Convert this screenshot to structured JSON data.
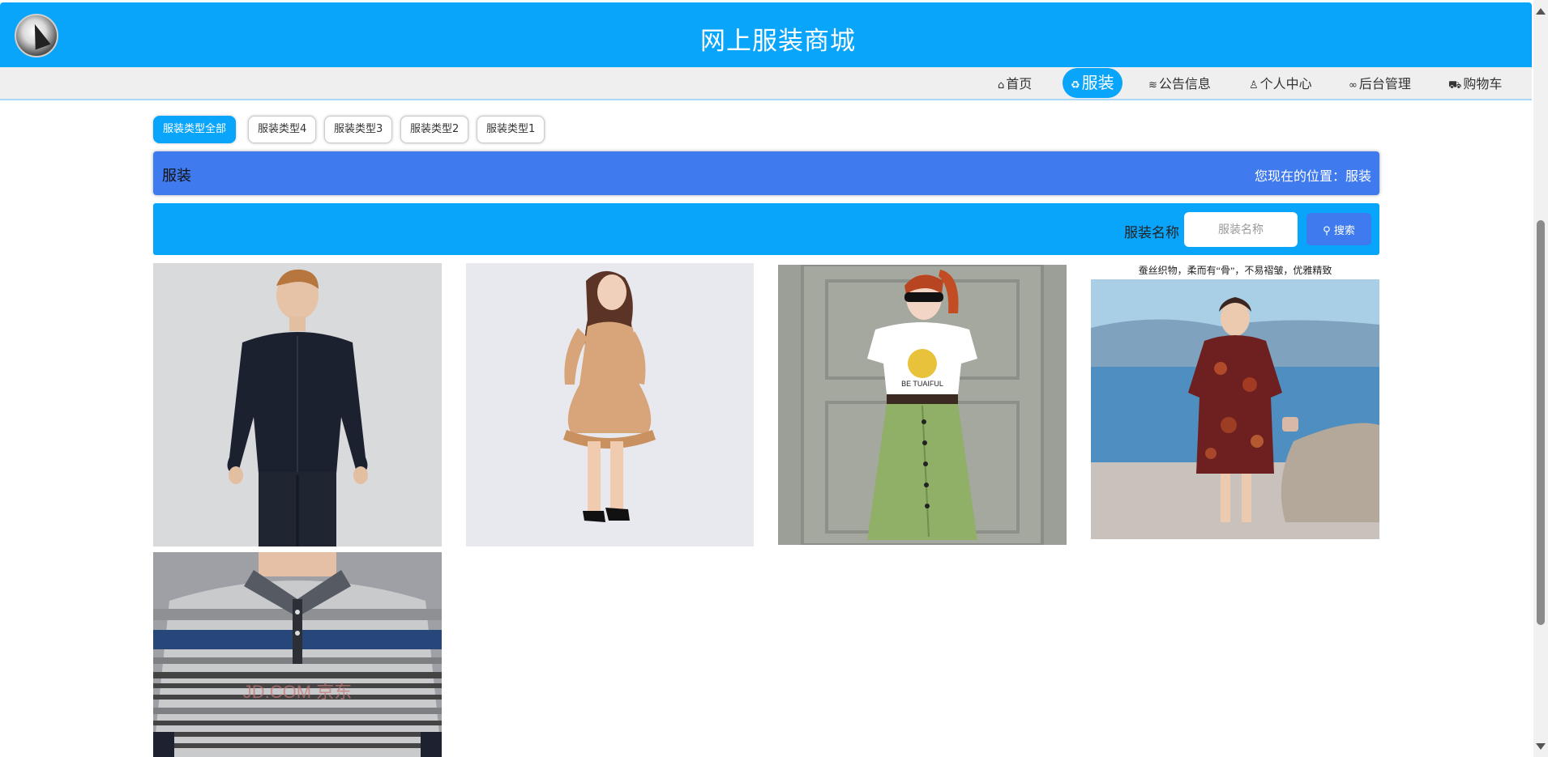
{
  "header": {
    "title": "网上服装商城",
    "logo_icon": "logo-icon"
  },
  "nav": {
    "items": [
      {
        "label": "首页",
        "icon": "home-icon",
        "glyph": "⌂"
      },
      {
        "label": "服装",
        "icon": "recycle-icon",
        "glyph": "♻",
        "active": true
      },
      {
        "label": "公告信息",
        "icon": "layers-icon",
        "glyph": "≋"
      },
      {
        "label": "个人中心",
        "icon": "user-icon",
        "glyph": "♙"
      },
      {
        "label": "后台管理",
        "icon": "link-icon",
        "glyph": "∞"
      },
      {
        "label": "购物车",
        "icon": "cart-icon",
        "glyph": "⛟"
      }
    ]
  },
  "categories": {
    "items": [
      "服装类型全部",
      "服装类型4",
      "服装类型3",
      "服装类型2",
      "服装类型1"
    ],
    "active_index": 0
  },
  "breadcrumb": {
    "title": "服装",
    "location": "您现在的位置：服装"
  },
  "search": {
    "label": "服装名称",
    "placeholder": "服装名称",
    "button_label": "搜索",
    "button_icon": "search-icon"
  },
  "products": [
    {
      "name": "product-image-jacket"
    },
    {
      "name": "product-image-dress"
    },
    {
      "name": "product-image-skirt-outfit",
      "shirt_text": "BE TUAIFUL"
    },
    {
      "name": "product-image-floral-dress",
      "caption": "蚕丝织物，柔而有“骨”，不易褶皱，优雅精致"
    },
    {
      "name": "product-image-polo",
      "watermark": "JD.COM 京东"
    }
  ],
  "colors": {
    "primary": "#09a5fb",
    "breadcrumb": "#3f7aee",
    "nav_bg": "#efefef"
  }
}
